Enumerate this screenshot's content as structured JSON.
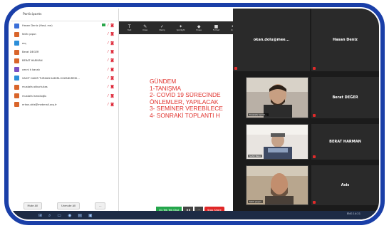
{
  "participants": {
    "header": "Participants",
    "list": [
      {
        "name": "Hasan Deniz (Host, me)",
        "avatar_color": "#3b6fd8",
        "highlight": true
      },
      {
        "name": "fatih çaşan",
        "avatar_color": "#d9652b"
      },
      {
        "name": "ecç",
        "avatar_color": "#2b8ed9"
      },
      {
        "name": "Berat DEĞER",
        "avatar_color": "#d9652b"
      },
      {
        "name": "BERAT HARMAN",
        "avatar_color": "#d9652b"
      },
      {
        "name": "cenni k kanalı",
        "avatar_color": "#7a4fc4"
      },
      {
        "name": "SAHIT HAKIR TURKAN KADIRLI KIZABUREDI...",
        "avatar_color": "#2b8ed9"
      },
      {
        "name": "mustafa akkurtukas",
        "avatar_color": "#d9652b"
      },
      {
        "name": "mustafa İsmailoğlu",
        "avatar_color": "#d9652b"
      },
      {
        "name": "erkan.akis@mebmail.org.tr",
        "avatar_color": "#d9652b"
      }
    ],
    "footer_buttons": [
      "Mute All",
      "Unmute All",
      "..."
    ]
  },
  "whiteboard": {
    "tools": [
      {
        "icon": "T",
        "label": "Text"
      },
      {
        "icon": "✎",
        "label": "Draw"
      },
      {
        "icon": "✓",
        "label": "Stamp"
      },
      {
        "icon": "✦",
        "label": "Spotlight"
      },
      {
        "icon": "◆",
        "label": "Erase"
      },
      {
        "icon": "■",
        "label": "Format"
      },
      {
        "icon": "↶",
        "label": "Undo"
      }
    ],
    "lines": [
      "GÜNDEM",
      "1-TANIŞMA",
      "2- COVID 19 SÜRECİNDE",
      "ÖNLEMLER, YAPILACAK",
      "3- SEMİNER VEREBİLECE",
      "4- SONRAKİ TOPLANTI H"
    ]
  },
  "gallery": {
    "left": [
      {
        "name": "okan.dolu@mee..."
      },
      {
        "name": "",
        "label": "Mustafa Semih..."
      },
      {
        "name": "",
        "label": "Sahit Bakır"
      },
      {
        "name": "",
        "label": "fatih çaşan"
      }
    ],
    "right": [
      {
        "name": "Hasan Deniz"
      },
      {
        "name": "Berat DEĞER"
      },
      {
        "name": "BERAT HARMAN"
      },
      {
        "name": "Asis"
      }
    ]
  },
  "controls": {
    "recording_label": "Q1 Tek Tek Okul",
    "stop_share_label": "Stop Share"
  },
  "taskbar": {
    "tray_text": "ENG 14:21"
  }
}
